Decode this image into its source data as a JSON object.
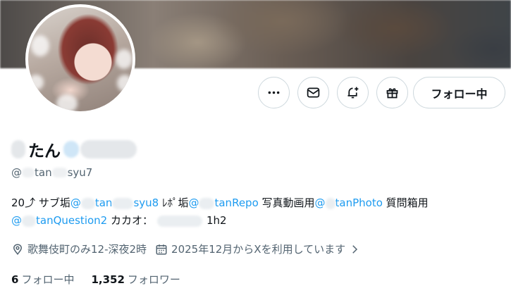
{
  "profile": {
    "name_suffix": "たん",
    "handle_prefix": "@",
    "handle_mid": "tan",
    "handle_suffix": "syu7",
    "bio": {
      "line1_a": "20⤴ サブ垢",
      "sub_at": "@",
      "sub_mid": "tan",
      "sub_suffix": "syu8",
      "repo_label": " ﾚﾎﾟ垢",
      "repo_at": "@",
      "repo_suffix": "tanRepo",
      "photo_label": " 写真動画用",
      "photo_at": "@",
      "photo_suffix": "tanPhoto",
      "question_label": " 質問箱用",
      "question_at": "@",
      "question_suffix": "tanQuestion2",
      "kakao_label": " カカオ：",
      "kakao_suffix": "1h2"
    },
    "location": "歌舞伎町のみ12-深夜2時",
    "joined": "2025年12月からXを利用しています",
    "following_count": "6",
    "following_label": "フォロー中",
    "followers_count": "1,352",
    "followers_label": "フォロワー"
  },
  "actions": {
    "follow_label": "フォロー中",
    "icons": [
      "more-icon",
      "message-icon",
      "notify-icon",
      "gift-icon"
    ]
  },
  "colors": {
    "link": "#1d9bf0",
    "muted": "#536471",
    "text": "#0f1419",
    "border": "#cfd9de"
  }
}
